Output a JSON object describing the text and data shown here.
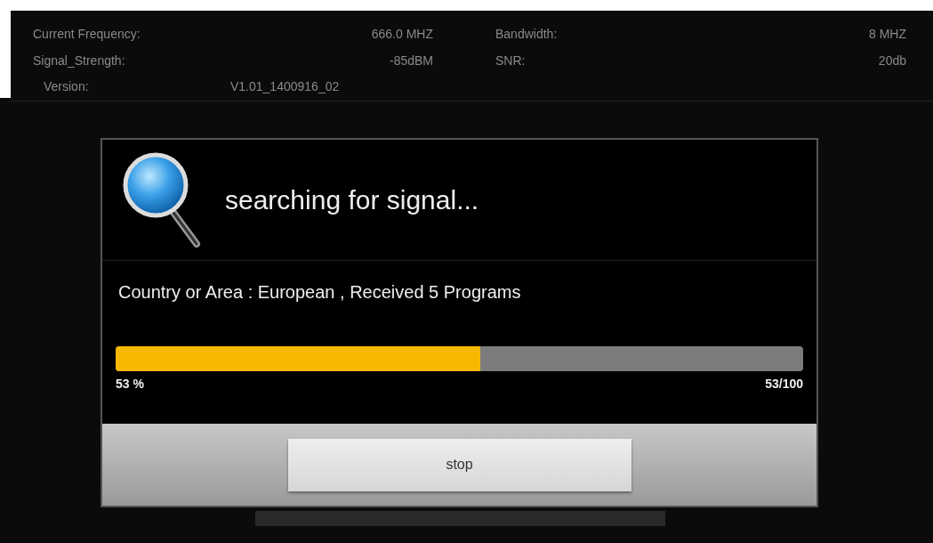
{
  "info": [
    {
      "label": "Current Frequency:",
      "value": "666.0 MHZ"
    },
    {
      "label": "Bandwidth:",
      "value": "8 MHZ"
    },
    {
      "label": "Signal_Strength:",
      "value": "-85dBM"
    },
    {
      "label": "SNR:",
      "value": "20db"
    },
    {
      "label": "Version:",
      "value": "V1.01_1400916_02"
    }
  ],
  "dialog": {
    "title": "searching for signal...",
    "message": "Country or Area : European , Received 5 Programs",
    "progress": {
      "level": 0.53,
      "percent": "53 %",
      "count": "53/100"
    },
    "button": "stop"
  }
}
